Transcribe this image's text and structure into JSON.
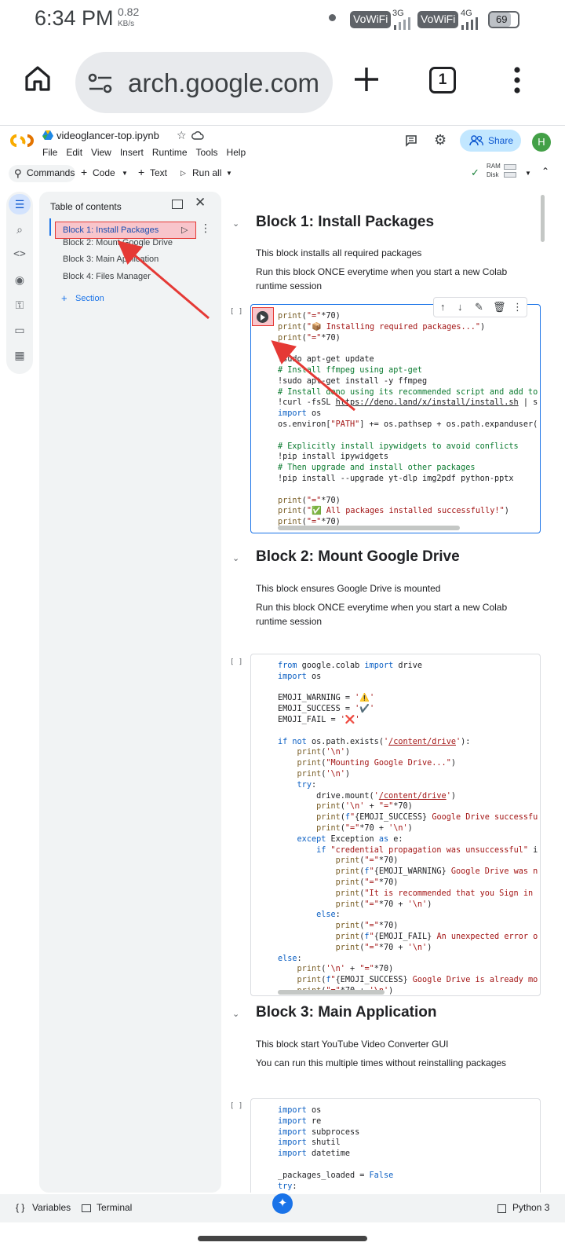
{
  "status": {
    "time": "6:34 PM",
    "speed_value": "0.82",
    "speed_unit": "KB/s",
    "wifi_badge": "VoWiFi",
    "net3g": "3G",
    "net4g": "4G",
    "battery": "69"
  },
  "browser": {
    "url": "arch.google.com",
    "tab_count": "1"
  },
  "colab": {
    "filename": "videoglancer-top.ipynb",
    "menu": [
      "File",
      "Edit",
      "View",
      "Insert",
      "Runtime",
      "Tools",
      "Help"
    ],
    "share_label": "Share",
    "avatar_letter": "H",
    "toolbar": {
      "commands": "Commands",
      "code": "Code",
      "text": "Text",
      "run_all": "Run all",
      "ram": "RAM",
      "disk": "Disk"
    }
  },
  "toc": {
    "title": "Table of contents",
    "items": [
      "Block 1: Install Packages",
      "Block 2: Mount Google Drive",
      "Block 3: Main Application",
      "Block 4: Files Manager"
    ],
    "add_section": "Section"
  },
  "notebook": {
    "block1": {
      "heading": "Block 1: Install Packages",
      "p1": "This block installs all required packages",
      "p2": "Run this block ONCE everytime when you start a new Colab runtime session"
    },
    "block2": {
      "heading": "Block 2: Mount Google Drive",
      "p1": "This block ensures Google Drive is mounted",
      "p2": "Run this block ONCE everytime when you start a new Colab runtime session"
    },
    "block3": {
      "heading": "Block 3: Main Application",
      "p1": "This block start YouTube Video Converter GUI",
      "p2": "You can run this multiple times without reinstalling packages"
    },
    "cell_bracket": "[ ]"
  },
  "bottom": {
    "variables": "Variables",
    "terminal": "Terminal",
    "runtime": "Python 3"
  },
  "colors": {
    "accent": "#1a73e8",
    "annotation_red": "#e53935",
    "share_bg": "#c2e7ff"
  }
}
